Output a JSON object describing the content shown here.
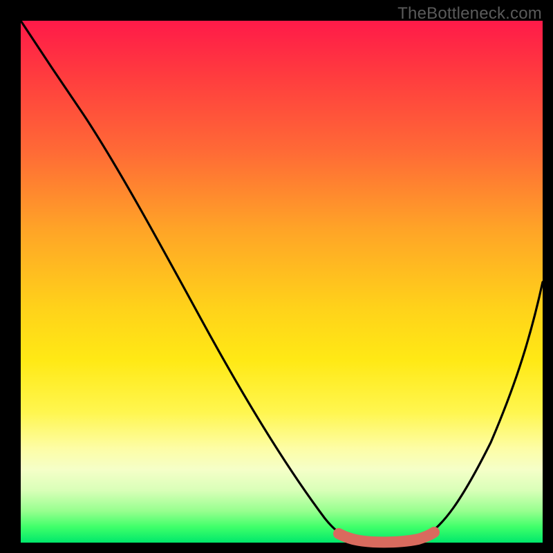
{
  "watermark": "TheBottleneck.com",
  "colors": {
    "background": "#000000",
    "curve": "#000000",
    "highlight": "#d96a5e",
    "gradient_top": "#ff1a49",
    "gradient_bottom": "#00e86b"
  },
  "chart_data": {
    "type": "line",
    "title": "",
    "xlabel": "",
    "ylabel": "",
    "xlim": [
      0,
      100
    ],
    "ylim": [
      0,
      100
    ],
    "grid": false,
    "series": [
      {
        "name": "bottleneck_curve",
        "x": [
          0,
          6,
          12,
          18,
          24,
          30,
          36,
          42,
          48,
          54,
          60,
          64,
          68,
          72,
          76,
          80,
          84,
          88,
          92,
          96,
          100
        ],
        "y": [
          100,
          91,
          82,
          72,
          62,
          52,
          42,
          33,
          24,
          16,
          8,
          3,
          1,
          0,
          0,
          2,
          7,
          15,
          25,
          37,
          50
        ]
      },
      {
        "name": "optimal_range_highlight",
        "x": [
          62,
          66,
          70,
          74,
          78
        ],
        "y": [
          1.5,
          0.5,
          0,
          0.3,
          1.2
        ]
      }
    ],
    "annotations": []
  }
}
